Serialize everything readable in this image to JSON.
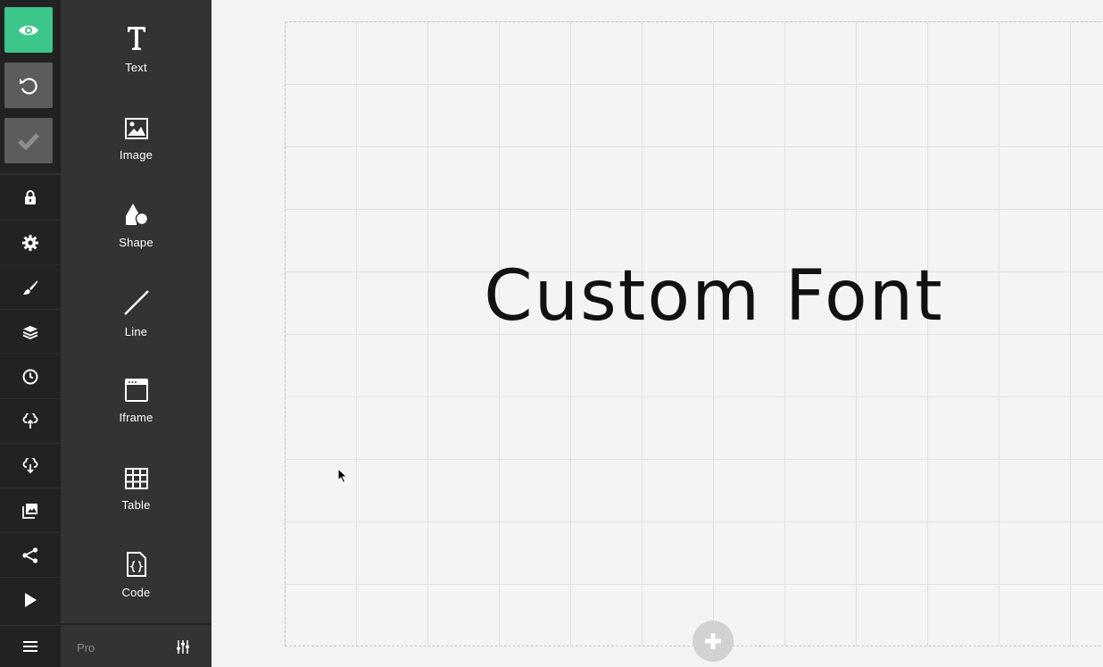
{
  "rail": {
    "top_buttons": [
      {
        "name": "preview",
        "icon": "eye-icon",
        "color": "#3cc68a"
      },
      {
        "name": "undo",
        "icon": "undo-icon",
        "color": "#5c5c5c"
      },
      {
        "name": "save",
        "icon": "checkmark-icon",
        "color": "#5c5c5c"
      }
    ],
    "items": [
      {
        "icon": "lock-icon"
      },
      {
        "icon": "gear-icon"
      },
      {
        "icon": "brush-icon"
      },
      {
        "icon": "layers-icon"
      },
      {
        "icon": "clock-icon"
      },
      {
        "icon": "cloud-upload-icon"
      },
      {
        "icon": "cloud-download-icon"
      },
      {
        "icon": "image-gallery-icon"
      },
      {
        "icon": "share-icon"
      },
      {
        "icon": "play-icon"
      }
    ],
    "bottom": {
      "icon": "hamburger-menu-icon"
    }
  },
  "panel": {
    "tools": [
      {
        "label": "Text",
        "icon": "text-icon"
      },
      {
        "label": "Image",
        "icon": "image-icon"
      },
      {
        "label": "Shape",
        "icon": "shape-icon"
      },
      {
        "label": "Line",
        "icon": "line-icon"
      },
      {
        "label": "Iframe",
        "icon": "iframe-icon"
      },
      {
        "label": "Table",
        "icon": "table-icon"
      },
      {
        "label": "Code",
        "icon": "code-icon"
      }
    ],
    "footer": {
      "pro_label": "Pro",
      "settings_icon": "sliders-icon"
    }
  },
  "canvas": {
    "headline": "Custom Font",
    "add_icon": "plus-icon"
  },
  "colors": {
    "accent": "#3cc68a",
    "rail_bg": "#222222",
    "panel_bg": "#333333",
    "canvas_bg": "#f3f3f3"
  }
}
